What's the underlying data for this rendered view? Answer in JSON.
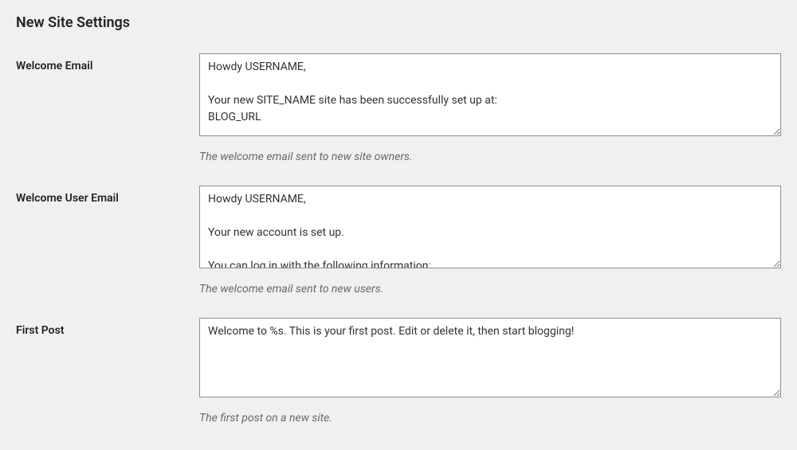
{
  "section_heading": "New Site Settings",
  "fields": {
    "welcome_email": {
      "label": "Welcome Email",
      "value": "Howdy USERNAME,\n\nYour new SITE_NAME site has been successfully set up at:\nBLOG_URL",
      "description": "The welcome email sent to new site owners."
    },
    "welcome_user_email": {
      "label": "Welcome User Email",
      "value": "Howdy USERNAME,\n\nYour new account is set up.\n\nYou can log in with the following information:",
      "description": "The welcome email sent to new users."
    },
    "first_post": {
      "label": "First Post",
      "value": "Welcome to %s. This is your first post. Edit or delete it, then start blogging!",
      "description": "The first post on a new site."
    }
  }
}
